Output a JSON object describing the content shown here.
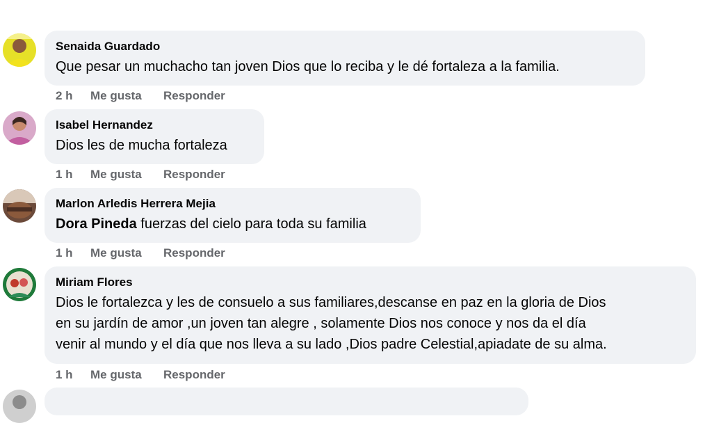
{
  "comments": [
    {
      "author": "Senaida Guardado",
      "mention": "",
      "text": "Que pesar un muchacho tan joven Dios que lo reciba y le dé fortaleza a la familia.",
      "time": "2 h",
      "like_label": "Me gusta",
      "reply_label": "Responder"
    },
    {
      "author": "Isabel Hernandez",
      "mention": "",
      "text": "Dios les de mucha fortaleza",
      "time": "1 h",
      "like_label": "Me gusta",
      "reply_label": "Responder"
    },
    {
      "author": "Marlon Arledis Herrera Mejia",
      "mention": "Dora Pineda",
      "text": " fuerzas del cielo para toda su familia",
      "time": "1 h",
      "like_label": "Me gusta",
      "reply_label": "Responder"
    },
    {
      "author": "Miriam Flores",
      "mention": "",
      "text_lines": [
        "Dios le fortalezca y les de consuelo a sus familiares,descanse en paz en la gloria de Dios",
        "en su jardín de amor ,un joven tan alegre , solamente Dios nos conoce y nos da el día",
        "venir al mundo y el día que nos lleva a su lado ,Dios padre Celestial,apiadate de su alma."
      ],
      "time": "1 h",
      "like_label": "Me gusta",
      "reply_label": "Responder"
    }
  ],
  "colors": {
    "bubble_bg": "#f0f2f5",
    "text": "#050505",
    "action_text": "#65676b"
  },
  "icons": [
    "avatar-photo"
  ]
}
